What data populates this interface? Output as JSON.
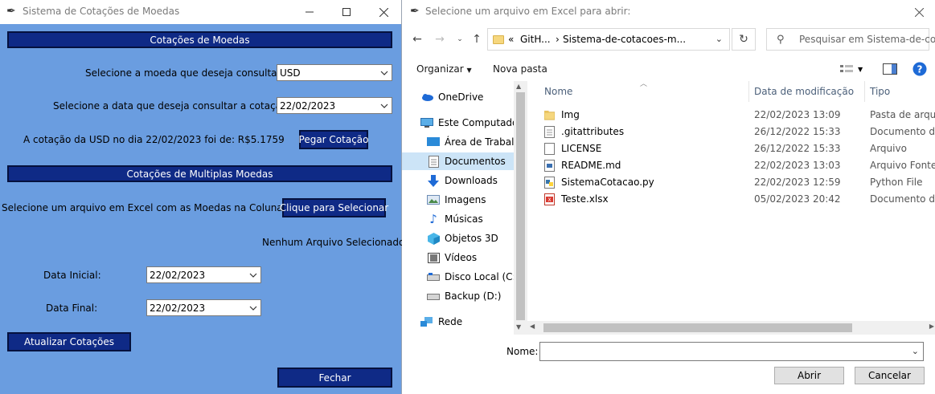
{
  "tk": {
    "title": "Sistema de Cotações de Moedas",
    "section1": "Cotações de Moedas",
    "label_moeda": "Selecione a moeda que deseja consultar:",
    "moeda_value": "USD",
    "label_data": "Selecione a data que deseja consultar a cotação:",
    "data_value": "22/02/2023",
    "result": "A cotação da USD no dia 22/02/2023 foi de: R$5.1759",
    "btn_pegar": "Pegar Cotação",
    "section2": "Cotações de Multiplas Moedas",
    "label_arquivo": "Selecione um arquivo em Excel com as Moedas na Coluna A:",
    "btn_selecionar": "Clique para Selecionar",
    "arquivo_status": "Nenhum Arquivo Selecionado",
    "label_data_inicial": "Data Inicial:",
    "data_inicial": "22/02/2023",
    "label_data_final": "Data Final:",
    "data_final": "22/02/2023",
    "btn_atualizar": "Atualizar Cotações",
    "btn_fechar": "Fechar",
    "colors": {
      "background": "#6a9de0",
      "button": "#0f2a86"
    }
  },
  "dialog": {
    "title": "Selecione um arquivo em Excel para abrir:",
    "breadcrumb_prefix": "«",
    "breadcrumb_1": "GitH...",
    "breadcrumb_sep": "›",
    "breadcrumb_2": "Sistema-de-cotacoes-m...",
    "search_placeholder": "Pesquisar em Sistema-de-co...",
    "organizar": "Organizar",
    "nova_pasta": "Nova pasta",
    "nav": [
      {
        "label": "OneDrive",
        "icon": "cloud-icon"
      },
      {
        "label": "Este Computador",
        "icon": "computer-icon"
      },
      {
        "label": "Área de Trabalho",
        "icon": "desktop-icon"
      },
      {
        "label": "Documentos",
        "icon": "documents-icon"
      },
      {
        "label": "Downloads",
        "icon": "download-icon"
      },
      {
        "label": "Imagens",
        "icon": "images-icon"
      },
      {
        "label": "Músicas",
        "icon": "music-icon"
      },
      {
        "label": "Objetos 3D",
        "icon": "cube-icon"
      },
      {
        "label": "Vídeos",
        "icon": "video-icon"
      },
      {
        "label": "Disco Local (C:)",
        "icon": "drive-icon"
      },
      {
        "label": "Backup (D:)",
        "icon": "drive-icon"
      },
      {
        "label": "Rede",
        "icon": "network-icon"
      }
    ],
    "columns": {
      "nome": "Nome",
      "data": "Data de modificação",
      "tipo": "Tipo"
    },
    "files": [
      {
        "name": "Img",
        "date": "22/02/2023 13:09",
        "type": "Pasta de arquivos",
        "icon": "folder-icon"
      },
      {
        "name": ".gitattributes",
        "date": "26/12/2022 15:33",
        "type": "Documento de Texto",
        "icon": "text-file-icon"
      },
      {
        "name": "LICENSE",
        "date": "26/12/2022 15:33",
        "type": "Arquivo",
        "icon": "file-icon"
      },
      {
        "name": "README.md",
        "date": "22/02/2023 13:03",
        "type": "Arquivo Fonte Markdown",
        "icon": "markdown-file-icon"
      },
      {
        "name": "SistemaCotacao.py",
        "date": "22/02/2023 12:59",
        "type": "Python File",
        "icon": "python-file-icon"
      },
      {
        "name": "Teste.xlsx",
        "date": "05/02/2023 20:42",
        "type": "Documento do Excel",
        "icon": "excel-file-icon"
      }
    ],
    "nome_label": "Nome:",
    "nome_value": "",
    "btn_abrir": "Abrir",
    "btn_cancelar": "Cancelar"
  }
}
